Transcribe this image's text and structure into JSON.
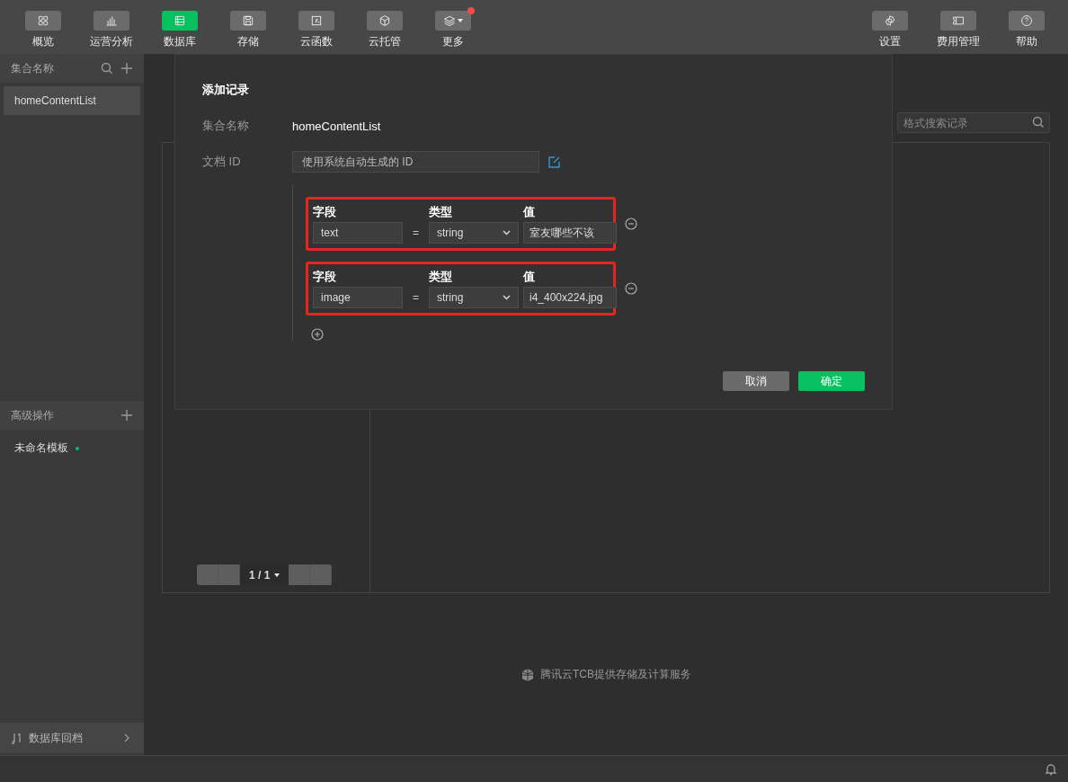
{
  "toolbar": {
    "left": [
      {
        "label": "概览",
        "selected": false,
        "badge": false,
        "caret": false
      },
      {
        "label": "运营分析",
        "selected": false,
        "badge": false,
        "caret": false
      },
      {
        "label": "数据库",
        "selected": true,
        "badge": false,
        "caret": false
      },
      {
        "label": "存储",
        "selected": false,
        "badge": false,
        "caret": false
      },
      {
        "label": "云函数",
        "selected": false,
        "badge": false,
        "caret": false
      },
      {
        "label": "云托管",
        "selected": false,
        "badge": false,
        "caret": false
      },
      {
        "label": "更多",
        "selected": false,
        "badge": true,
        "caret": true
      }
    ],
    "right": [
      {
        "label": "设置",
        "selected": false,
        "badge": false,
        "caret": false
      },
      {
        "label": "费用管理",
        "selected": false,
        "badge": false,
        "caret": false
      },
      {
        "label": "帮助",
        "selected": false,
        "badge": false,
        "caret": false
      }
    ]
  },
  "sidebar": {
    "collections_header": "集合名称",
    "collections": [
      {
        "label": "homeContentList",
        "selected": true
      }
    ],
    "advanced_header": "高级操作",
    "templates": [
      {
        "label": "未命名模板",
        "color": "#07c160"
      }
    ],
    "rollback": "数据库回档"
  },
  "main": {
    "search": {
      "placeholder": "格式搜索记录"
    },
    "pagination": {
      "page": "1 / 1"
    },
    "footer": "腾讯云TCB提供存储及计算服务"
  },
  "dialog": {
    "title": "添加记录",
    "collection_label": "集合名称",
    "collection_value": "homeContentList",
    "doc_id_label": "文档 ID",
    "doc_id_placeholder": "使用系统自动生成的 ID",
    "fields": [
      {
        "name_label": "字段",
        "type_label": "类型",
        "value_label": "值",
        "name": "text",
        "equals": "=",
        "type": "string",
        "value": "室友哪些不该",
        "highlighted": true
      },
      {
        "name_label": "字段",
        "type_label": "类型",
        "value_label": "值",
        "name": "image",
        "equals": "=",
        "type": "string",
        "value": "i4_400x224.jpg",
        "highlighted": true
      }
    ],
    "buttons": [
      {
        "label": "取消",
        "kind": "secondary"
      },
      {
        "label": "确定",
        "kind": "primary"
      }
    ]
  }
}
